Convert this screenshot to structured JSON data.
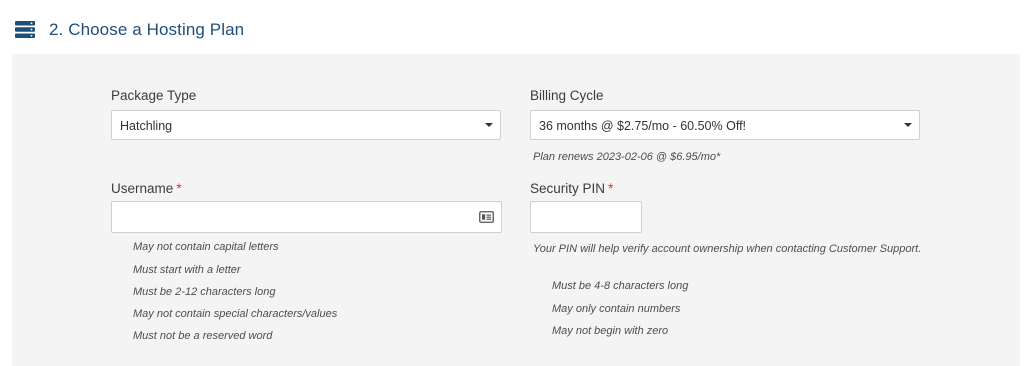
{
  "section": {
    "title": "2. Choose a Hosting Plan",
    "icon": "server-icon"
  },
  "package_type": {
    "label": "Package Type",
    "selected": "Hatchling"
  },
  "billing_cycle": {
    "label": "Billing Cycle",
    "selected": "36 months @ $2.75/mo - 60.50% Off!",
    "renew_note": "Plan renews 2023-02-06 @ $6.95/mo*"
  },
  "username": {
    "label": "Username",
    "required_mark": "*",
    "value": "",
    "icon": "id-card-icon",
    "rules": [
      "May not contain capital letters",
      "Must start with a letter",
      "Must be 2-12 characters long",
      "May not contain special characters/values",
      "Must not be a reserved word"
    ]
  },
  "security_pin": {
    "label": "Security PIN",
    "required_mark": "*",
    "value": "",
    "note": "Your PIN will help verify account ownership when contacting Customer Support.",
    "rules": [
      "Must be 4-8 characters long",
      "May only contain numbers",
      "May not begin with zero"
    ]
  },
  "colors": {
    "title": "#1f4e79",
    "required": "#d33a2c",
    "panel_bg": "#f4f4f4"
  }
}
